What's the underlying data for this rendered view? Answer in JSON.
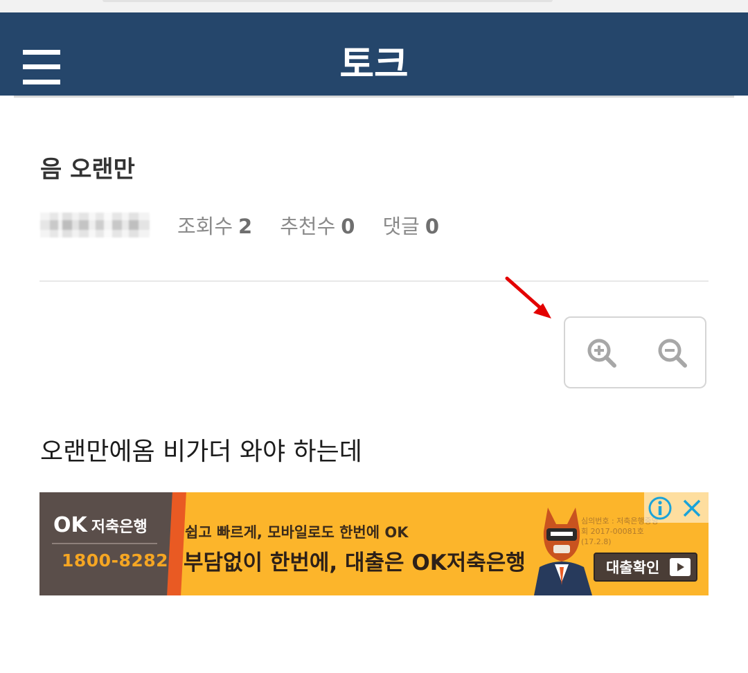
{
  "header": {
    "title": "토크"
  },
  "post": {
    "title": "음 오랜만",
    "meta": {
      "views_label": "조회수",
      "views": "2",
      "recommend_label": "추천수",
      "recommend": "0",
      "comments_label": "댓글",
      "comments": "0"
    },
    "body": "오랜만에옴 비가더 와야 하는데"
  },
  "ad": {
    "brand": "OK",
    "brand_sub": "저축은행",
    "phone": "1800-8282",
    "line1": "쉽고 빠르게, 모바일로도 한번에 OK",
    "line2": "부담없이 한번에, 대출은 OK저축은행",
    "cta": "대출확인",
    "fine_print": "심의번호 : 저축은행중앙회 2017-00081호 (17.2.8)"
  },
  "colors": {
    "header_bg": "#25466b",
    "ad_yellow": "#fcb52b",
    "ad_dark": "#5a4e4a",
    "annotation_red": "#e30000"
  },
  "icons": [
    "menu-icon",
    "zoom-in-icon",
    "zoom-out-icon",
    "info-icon",
    "close-icon",
    "play-icon"
  ]
}
